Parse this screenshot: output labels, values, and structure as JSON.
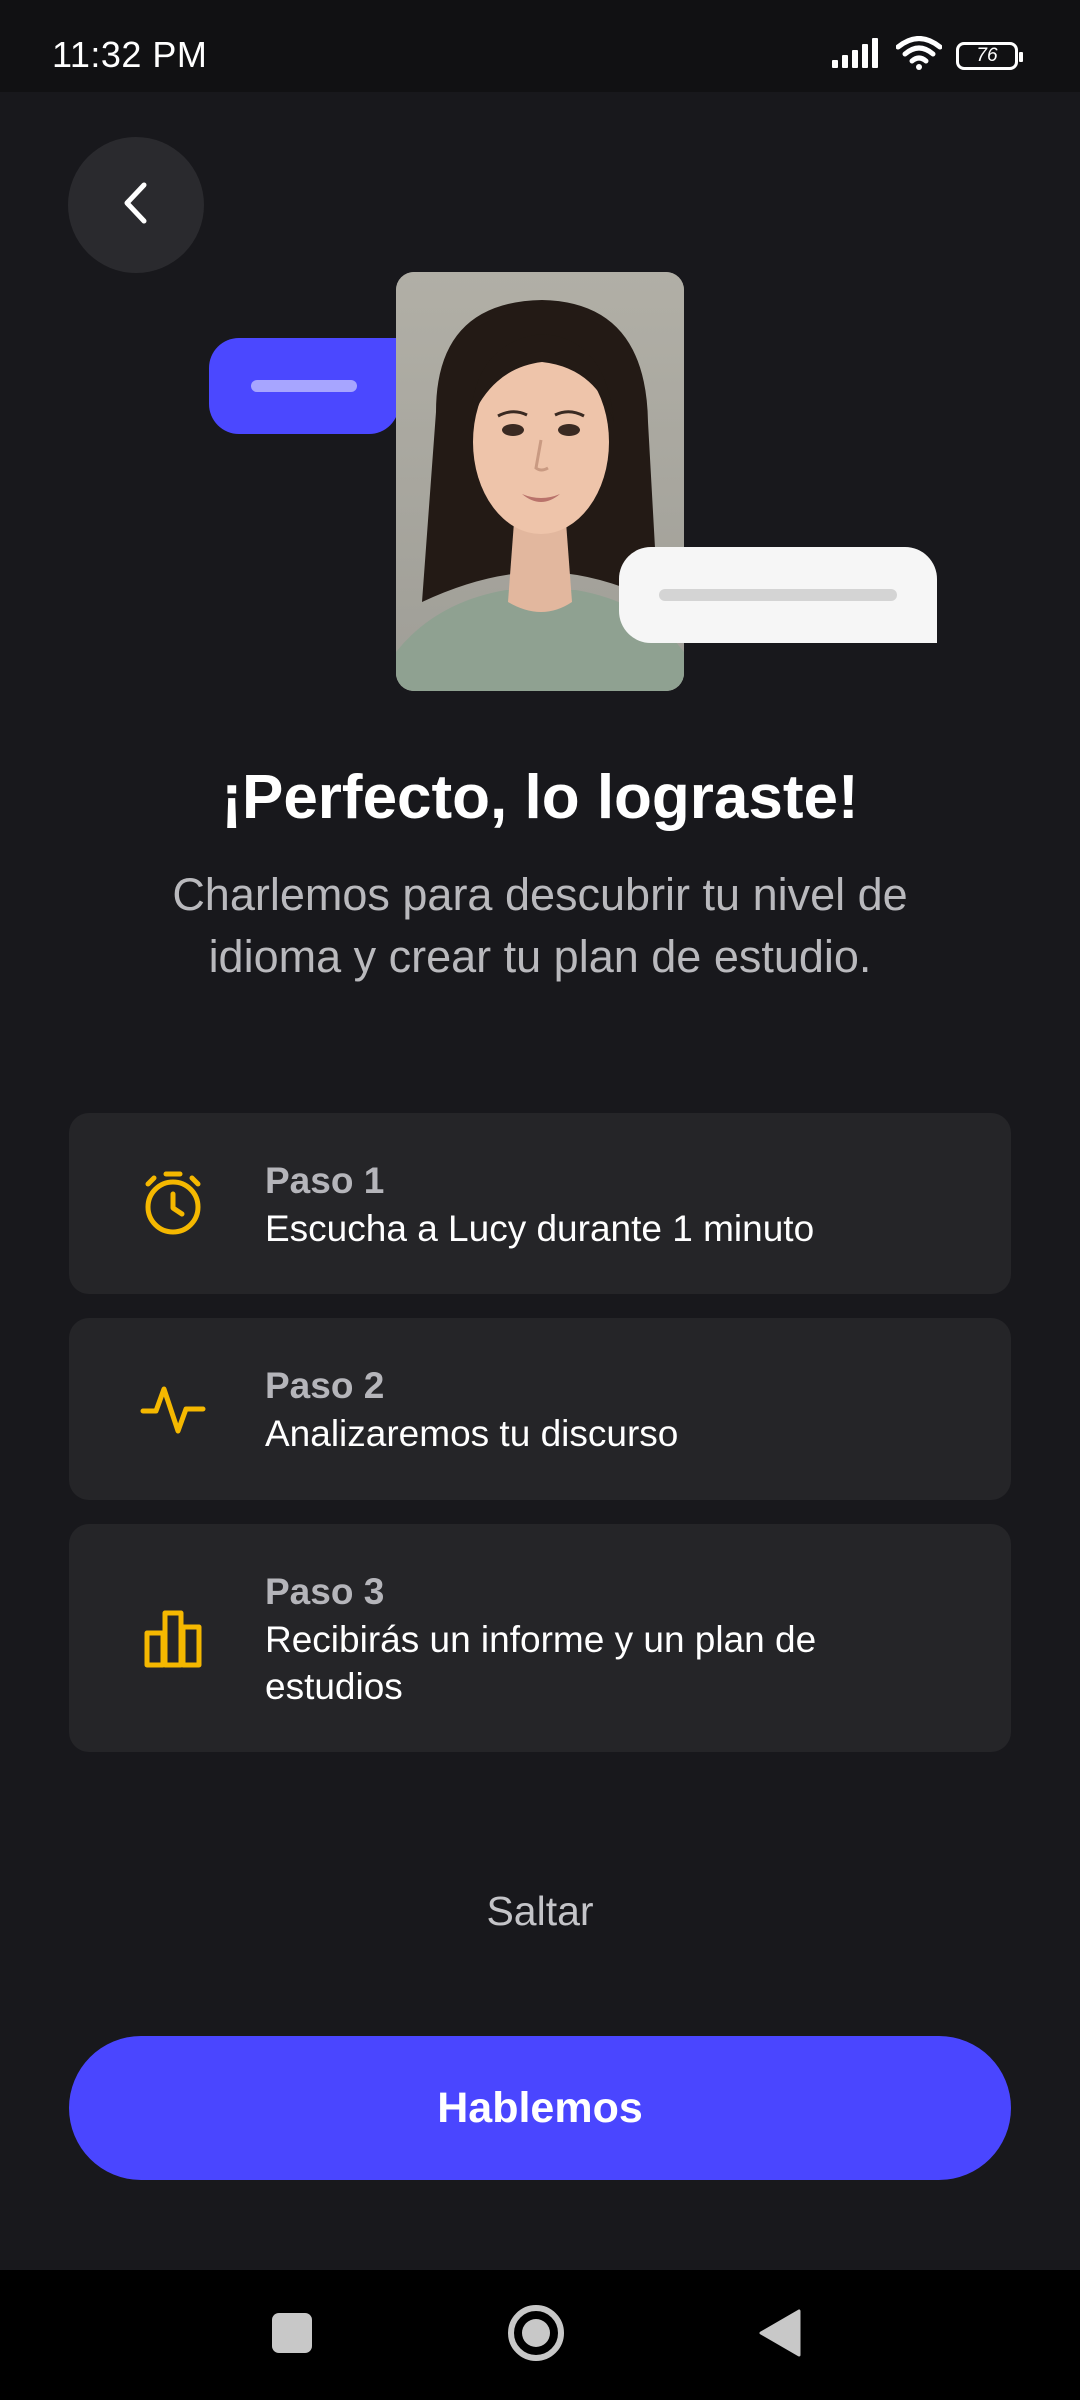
{
  "status_bar": {
    "time": "11:32 PM",
    "battery_level": "76",
    "icons": [
      "signal-icon",
      "wifi-icon",
      "battery-icon"
    ]
  },
  "header": {
    "back_icon": "chevron-left-icon"
  },
  "hero": {
    "title": "¡Perfecto, lo lograste!",
    "subtitle": "Charlemos para descubrir tu nivel de idioma y crear tu plan de estudio."
  },
  "steps": [
    {
      "label": "Paso 1",
      "text": "Escucha a Lucy durante 1 minuto",
      "icon": "stopwatch-icon"
    },
    {
      "label": "Paso 2",
      "text": "Analizaremos tu discurso",
      "icon": "pulse-icon"
    },
    {
      "label": "Paso 3",
      "text": "Recibirás un informe y un plan de estudios",
      "icon": "bar-chart-icon"
    }
  ],
  "actions": {
    "skip_label": "Saltar",
    "cta_label": "Hablemos"
  },
  "colors": {
    "background": "#18181c",
    "card": "#252528",
    "accent": "#4a46ff",
    "icon_accent": "#f5b800"
  },
  "nav_bar": {
    "icons": [
      "recents-icon",
      "home-icon",
      "back-icon"
    ]
  }
}
